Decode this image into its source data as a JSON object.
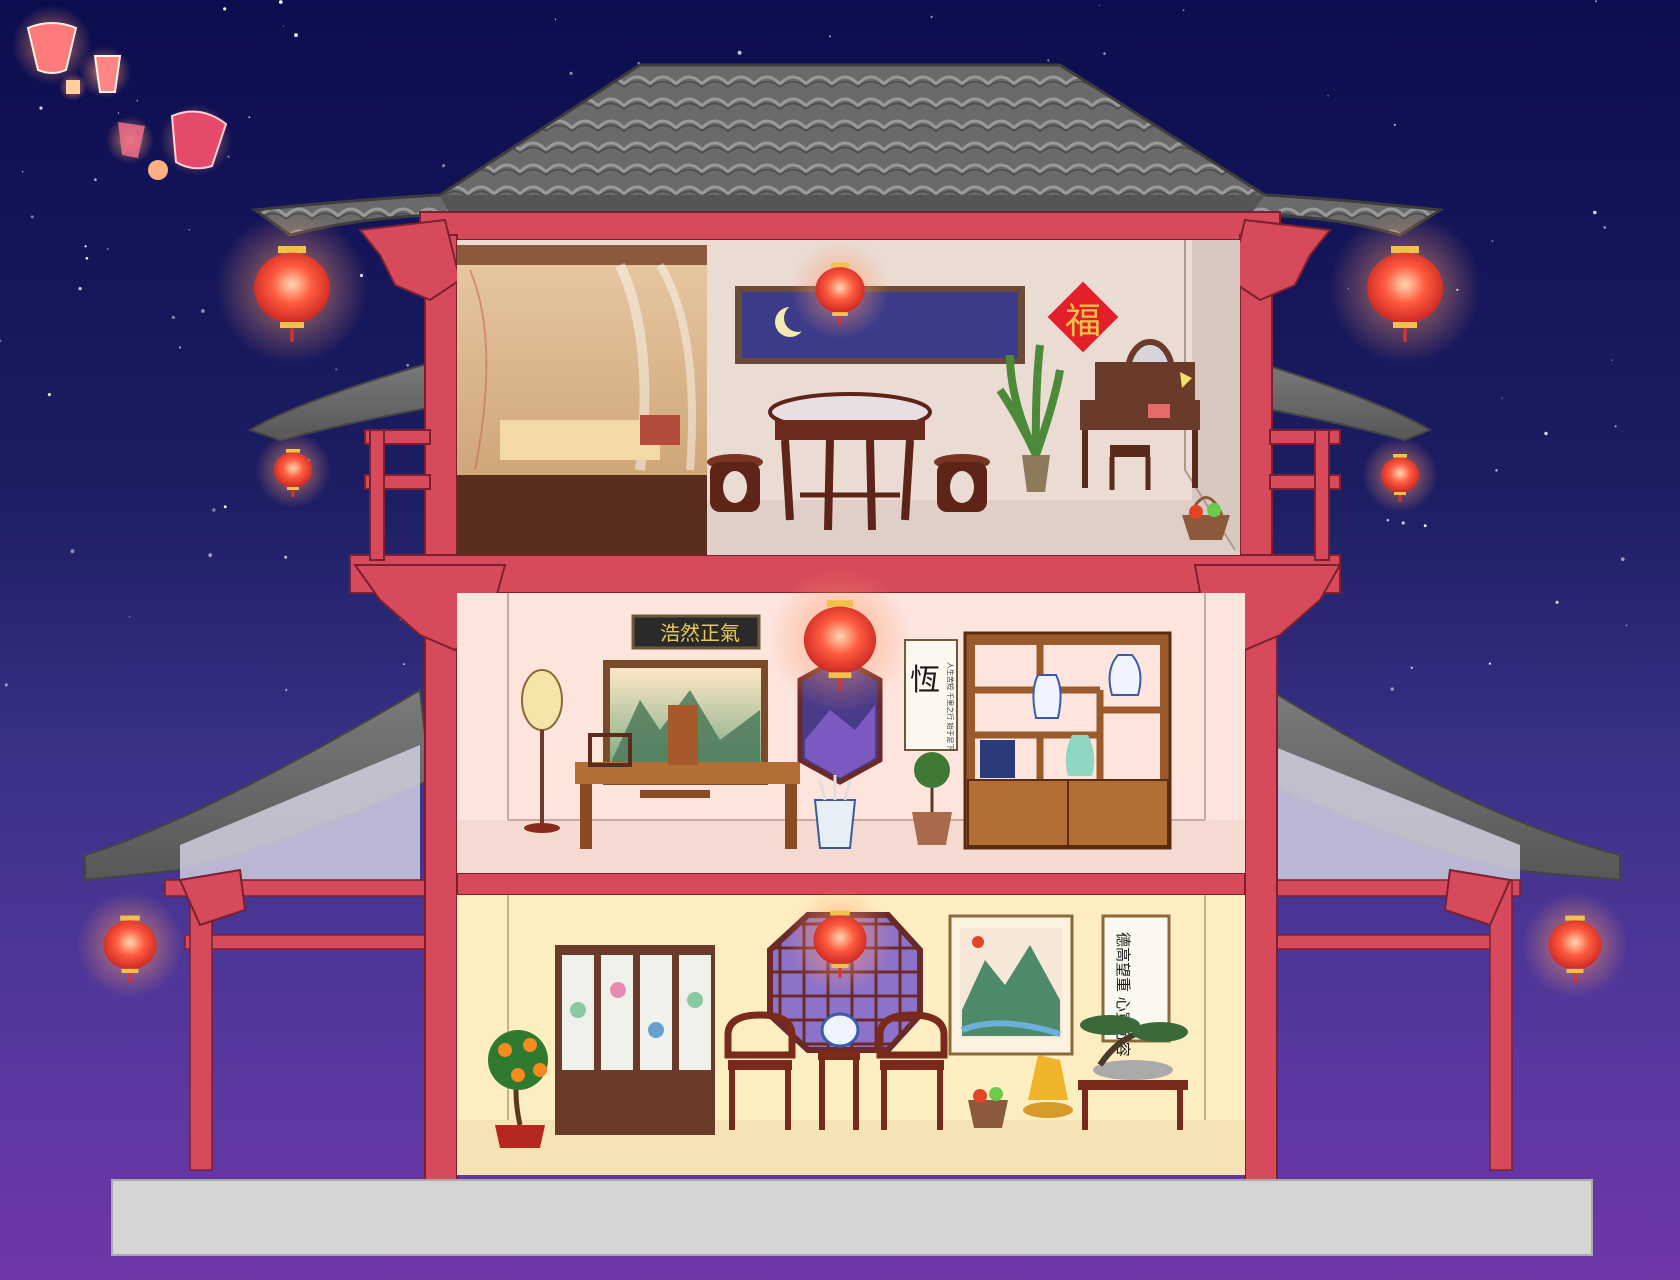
{
  "scene": {
    "sky_colors": [
      "#0e0e52",
      "#2b2a7a",
      "#6a3fa8",
      "#7a3bb0"
    ],
    "frame_color": "#d64a5b",
    "roof_color": "#6e6e6e",
    "lantern_color": "#ff3b2e"
  },
  "top_floor": {
    "moon_icon": "crescent-moon",
    "fu_character": "福"
  },
  "middle_floor": {
    "plaque_text": "浩然正氣",
    "scroll_main_char": "恆",
    "scroll_small_text": "人生苦短 千里之行 始于足下"
  },
  "ground_floor": {
    "couplet_text": "德高望重 心寬可容"
  }
}
